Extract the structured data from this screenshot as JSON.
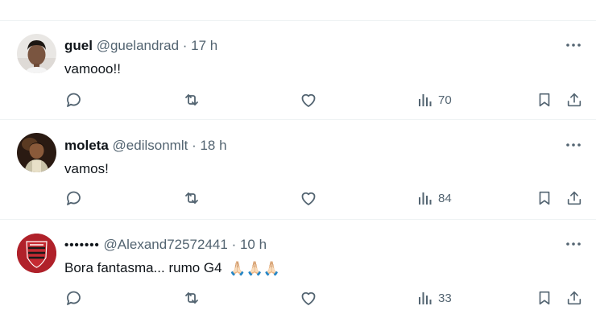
{
  "colors": {
    "text_primary": "#0f1419",
    "text_secondary": "#536471",
    "divider": "#eff3f4"
  },
  "replies": [
    {
      "display_name": "guel",
      "handle": "@guelandrad",
      "separator": "·",
      "time": "17 h",
      "text": "vamooo!!",
      "views": "70",
      "avatar": "profile-photo-young-man"
    },
    {
      "display_name": "moleta",
      "handle": "@edilsonmlt",
      "separator": "·",
      "time": "18 h",
      "text": "vamos!",
      "views": "84",
      "avatar": "profile-photo-dark"
    },
    {
      "display_name": "•••••••",
      "handle": "@Alexand72572441",
      "separator": "·",
      "time": "10 h",
      "text": "Bora fantasma... rumo G4",
      "emojis": "🙏🏻🙏🏻🙏🏻",
      "views": "33",
      "avatar": "athletico-paranaense-crest"
    }
  ],
  "icons": {
    "more": "more-horizontal-icon",
    "reply": "reply-bubble-icon",
    "repost": "repost-icon",
    "like": "heart-icon",
    "views": "views-bar-chart-icon",
    "bookmark": "bookmark-icon",
    "share": "share-upload-icon"
  }
}
